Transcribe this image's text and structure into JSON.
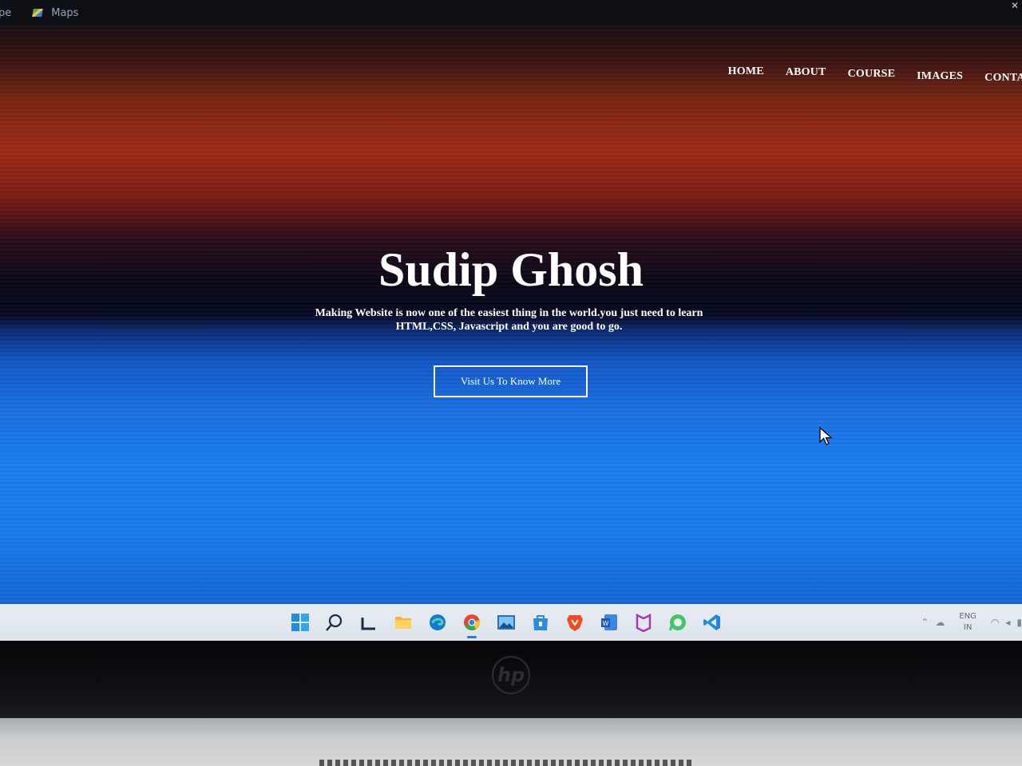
{
  "browser": {
    "bookmark_fragment": "pe",
    "bookmark_maps": "Maps"
  },
  "nav": {
    "items": [
      "HOME",
      "ABOUT",
      "COURSE",
      "IMAGES",
      "CONTAC"
    ]
  },
  "hero": {
    "title": "Sudip Ghosh",
    "text": "Making Website is now one of the easiest thing in the world.you just need to learn HTML,CSS, Javascript and you are good to go.",
    "button_label": "Visit Us To Know More"
  },
  "taskbar": {
    "icons": [
      "windows-start-icon",
      "search-icon",
      "widgets-icon",
      "file-explorer-icon",
      "edge-icon",
      "chrome-icon",
      "photos-icon",
      "store-icon",
      "brave-icon",
      "word-icon",
      "mcafee-icon",
      "whatsapp-icon",
      "vscode-icon"
    ],
    "tray_lang_line1": "ENG",
    "tray_lang_line2": "IN"
  },
  "colors": {
    "accent_blue": "#1a7cea",
    "sunset_red": "#9e2a16",
    "taskbar": "#e3e8ee"
  }
}
